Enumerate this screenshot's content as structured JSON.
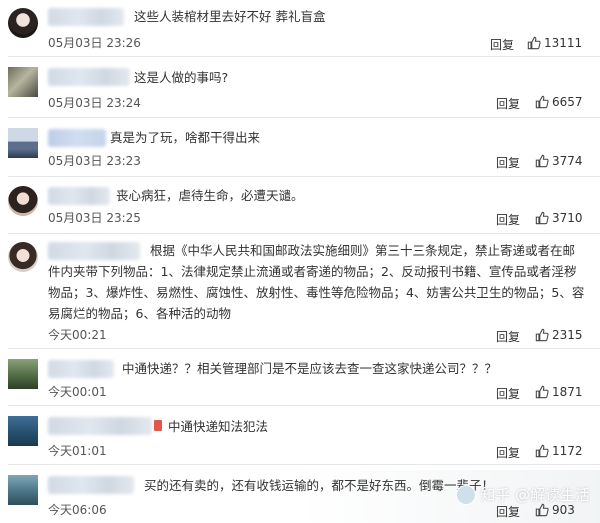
{
  "comments": [
    {
      "text": "这些人装棺材里去好不好 葬礼盲盒",
      "time": "05月03日 23:26",
      "reply": "回复",
      "likes": "13111"
    },
    {
      "text": "这是人做的事吗?",
      "time": "05月03日 23:24",
      "reply": "回复",
      "likes": "6657"
    },
    {
      "text": "真是为了玩，啥都干得出来",
      "time": "05月03日 23:23",
      "reply": "回复",
      "likes": "3774"
    },
    {
      "text": "丧心病狂，虐待生命，必遭天谴。",
      "time": "05月03日 23:25",
      "reply": "回复",
      "likes": "3710"
    },
    {
      "text": "根据《中华人民共和国邮政法实施细则》第三十三条规定，禁止寄递或者在邮件内夹带下列物品：1、法律规定禁止流通或者寄递的物品；2、反动报刊书籍、宣传品或者淫秽物品；3、爆炸性、易燃性、腐蚀性、放射性、毒性等危险物品；4、妨害公共卫生的物品；5、容易腐烂的物品；6、各种活的动物",
      "time": "今天00:21",
      "reply": "回复",
      "likes": "2315"
    },
    {
      "text": "中通快递？？相关管理部门是不是应该去查一查这家快递公司？？？",
      "time": "今天00:01",
      "reply": "回复",
      "likes": "1871"
    },
    {
      "text": "中通快递知法犯法",
      "time": "今天01:01",
      "reply": "回复",
      "likes": "1172"
    },
    {
      "text": "买的还有卖的，还有收钱运输的，都不是好东西。倒霉一辈子！",
      "time": "今天06:06",
      "reply": "回复",
      "likes": "903"
    }
  ],
  "watermark": "知乎 @解读生活",
  "icons": {
    "like": "thumbs-up-icon"
  }
}
